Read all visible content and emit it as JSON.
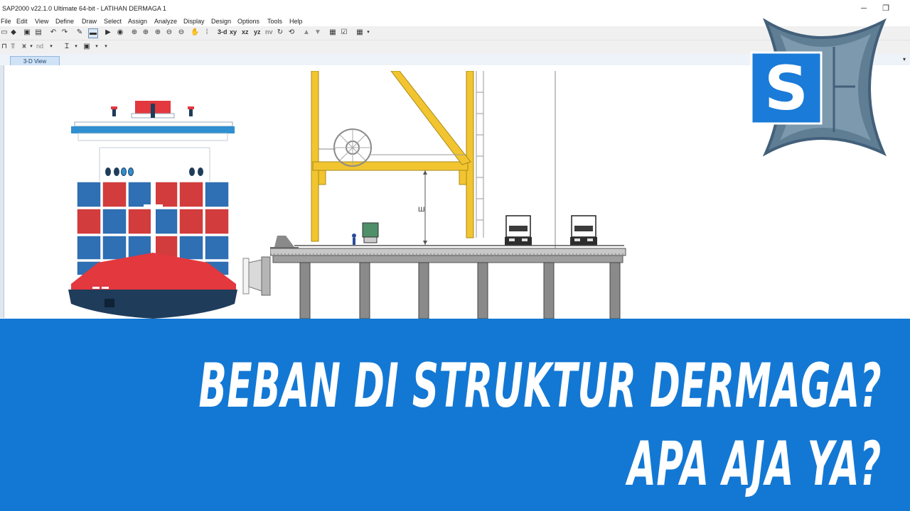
{
  "window": {
    "title": "SAP2000 v22.1.0 Ultimate 64-bit - LATIHAN DERMAGA 1",
    "minimize_glyph": "─",
    "maximize_glyph": "❐",
    "close_glyph": "✕"
  },
  "menu": [
    "File",
    "Edit",
    "View",
    "Define",
    "Draw",
    "Select",
    "Assign",
    "Analyze",
    "Display",
    "Design",
    "Options",
    "Tools",
    "Help"
  ],
  "toolbar": {
    "view_3d": "3-d",
    "view_xy": "xy",
    "view_xz": "xz",
    "view_yz": "yz",
    "view_nv": "nv",
    "nd_label": "nd"
  },
  "tabs": {
    "active": "3-D View"
  },
  "drawing": {
    "dimension_label": "ш"
  },
  "headline": {
    "line1": "BEBAN  DI STRUKTUR DERMAGA?",
    "line2": "APA AJA YA?"
  },
  "logo": {
    "letter": "S"
  },
  "colors": {
    "banner": "#1378d4",
    "crane": "#f2c530",
    "ship_hull": "#1f3c5a",
    "ship_red": "#e2383e",
    "container_blue": "#2f6fb3",
    "container_red": "#d23c3c",
    "logo_blue": "#1a7bd8",
    "logo_star": "#5f7d93"
  }
}
